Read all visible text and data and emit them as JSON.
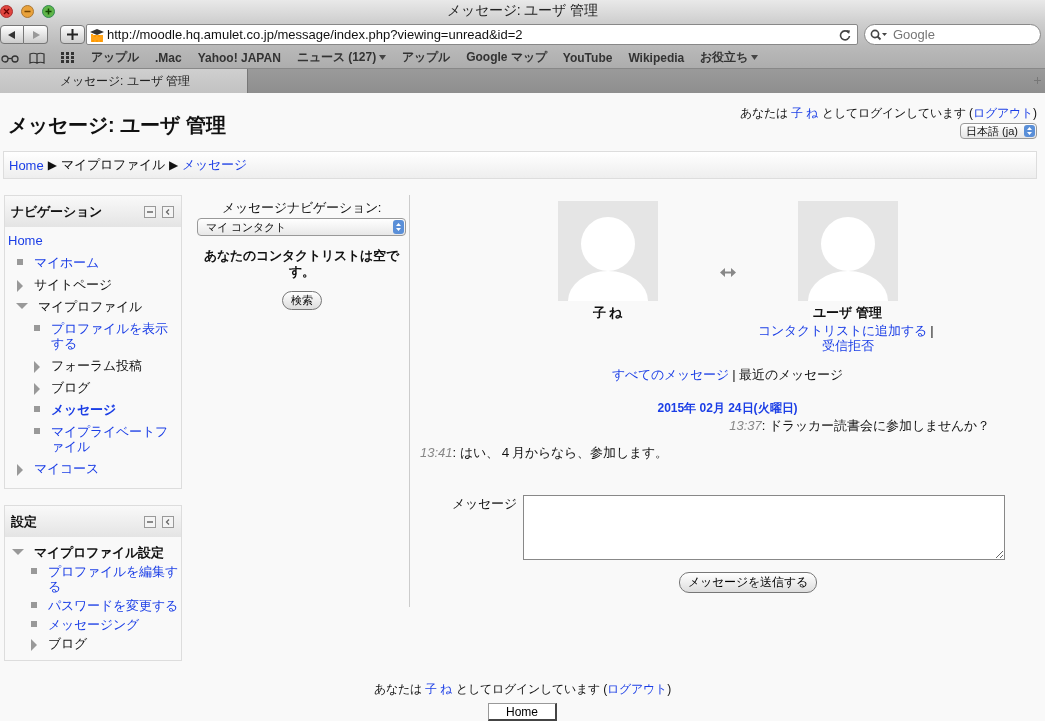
{
  "browser": {
    "title": "メッセージ: ユーザ 管理",
    "url": "http://moodle.hq.amulet.co.jp/message/index.php?viewing=unread&id=2",
    "search_placeholder": "Google",
    "bookmarks": [
      {
        "label": "アップル",
        "has_menu": false
      },
      {
        "label": ".Mac",
        "has_menu": false
      },
      {
        "label": "Yahoo! JAPAN",
        "has_menu": false
      },
      {
        "label": "ニュース (127)",
        "has_menu": true
      },
      {
        "label": "アップル",
        "has_menu": false
      },
      {
        "label": "Google マップ",
        "has_menu": false
      },
      {
        "label": "YouTube",
        "has_menu": false
      },
      {
        "label": "Wikipedia",
        "has_menu": false
      },
      {
        "label": "お役立ち",
        "has_menu": true
      }
    ],
    "tabs": [
      {
        "label": "メッセージ: ユーザ 管理",
        "selected": true
      }
    ]
  },
  "header": {
    "title": "メッセージ: ユーザ 管理",
    "login": {
      "prefix": "あなたは",
      "user": "子 ね",
      "middle": "としてログインしています (",
      "logout": "ログアウト",
      "suffix": ")"
    },
    "language": "日本語 (ja)"
  },
  "breadcrumb": {
    "separator": "▶",
    "items": [
      {
        "label": "Home",
        "link": true
      },
      {
        "label": "マイプロファイル",
        "link": false
      },
      {
        "label": "メッセージ",
        "link": true
      }
    ]
  },
  "navigation": {
    "title": "ナビゲーション",
    "tree": {
      "label": "Home",
      "link": true,
      "children": [
        {
          "label": "マイホーム",
          "kind": "leaf",
          "link": true
        },
        {
          "label": "サイトページ",
          "kind": "branch",
          "link": false,
          "expanded": false
        },
        {
          "label": "マイプロファイル",
          "kind": "branch",
          "link": false,
          "expanded": true,
          "children": [
            {
              "label": "プロファイルを表示する",
              "kind": "leaf",
              "link": true
            },
            {
              "label": "フォーラム投稿",
              "kind": "branch",
              "link": false,
              "expanded": false
            },
            {
              "label": "ブログ",
              "kind": "branch",
              "link": false,
              "expanded": false
            },
            {
              "label": "メッセージ",
              "kind": "leaf",
              "link": true,
              "current": true
            },
            {
              "label": "マイプライベートファイル",
              "kind": "leaf",
              "link": true
            }
          ]
        },
        {
          "label": "マイコース",
          "kind": "branch",
          "link": true,
          "expanded": false
        }
      ]
    }
  },
  "settings": {
    "title": "設定",
    "tree": {
      "label": "マイプロファイル設定",
      "kind": "branch",
      "link": false,
      "bold": true,
      "expanded": true,
      "children": [
        {
          "label": "プロファイルを編集する",
          "kind": "leaf",
          "link": true
        },
        {
          "label": "パスワードを変更する",
          "kind": "leaf",
          "link": true
        },
        {
          "label": "メッセージング",
          "kind": "leaf",
          "link": true
        },
        {
          "label": "ブログ",
          "kind": "branch",
          "link": false,
          "expanded": false
        }
      ]
    }
  },
  "message_navigation": {
    "label": "メッセージナビゲーション:",
    "select": "マイ コンタクト",
    "empty_text": "あなたのコンタクトリストは空です。",
    "search_button": "検索"
  },
  "conversation": {
    "users": [
      {
        "name": "子 ね"
      },
      {
        "name": "ユーザ 管理",
        "links": [
          "コンタクトリストに追加する",
          "受信拒否"
        ]
      }
    ],
    "link_separator": "|",
    "views": [
      {
        "label": "すべてのメッセージ",
        "selected": false
      },
      {
        "label": "最近のメッセージ",
        "selected": true
      }
    ],
    "date": "2015年 02月 24日(火曜日)",
    "time_separator": ":",
    "messages": [
      {
        "time": "13:37",
        "text": "ドラッカー読書会に参加しませんか？",
        "kind": "received"
      },
      {
        "time": "13:41",
        "text": "はい、４月からなら、参加します。",
        "kind": "sent"
      }
    ]
  },
  "compose": {
    "label": "メッセージ",
    "send_button": "メッセージを送信する"
  },
  "footer": {
    "login": {
      "prefix": "あなたは",
      "user": "子 ね",
      "middle": "としてログインしています (",
      "logout": "ログアウト",
      "suffix": ")"
    },
    "home_button": "Home"
  }
}
